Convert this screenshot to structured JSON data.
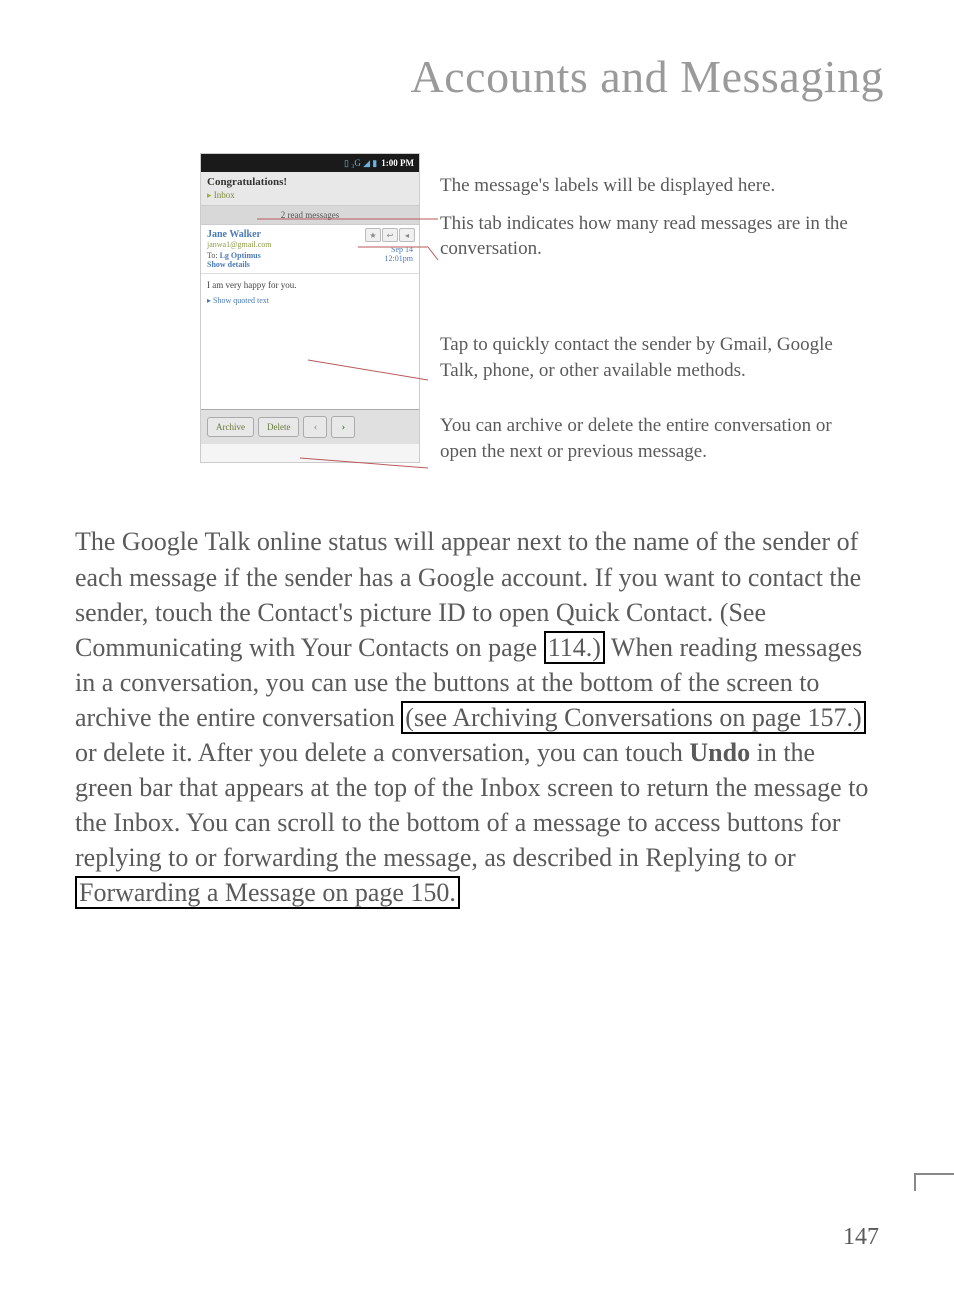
{
  "page_title": "Accounts and Messaging",
  "phone": {
    "status_time": "1:00 PM",
    "congrats": "Congratulations!",
    "inbox": "Inbox",
    "read_messages": "2 read messages",
    "sender_name": "Jane Walker",
    "sender_email": "janwa1@gmail.com",
    "to_prefix": "To:",
    "to_name": "Lg Optimus",
    "show_details": "Show details",
    "date": "Sep 14",
    "time": "12:01pm",
    "body_text": "I am very happy for you.",
    "quoted_text": "▸ Show quoted text",
    "archive_btn": "Archive",
    "delete_btn": "Delete"
  },
  "callouts": {
    "c1": "The message's labels will be displayed here.",
    "c2": "This tab indicates how many read messages are in the conversation.",
    "c3": "Tap to quickly contact the sender by Gmail, Google Talk, phone, or other available methods.",
    "c4": "You can archive or delete the entire conversation or open the next or previous message."
  },
  "main_text": {
    "p1a": "The Google Talk online status will appear next to the name of the sender of each message if the sender has a Google account. If you want to contact the sender, touch the Contact's picture ID to open Quick Contact. (See Communicating with Your Contacts on page ",
    "link1": "114.)",
    "p1b": " When reading messages in a conversation, you can use the buttons at the bottom of the screen to archive the entire conversation ",
    "link2": "(see Archiving Conversations on page 157.)",
    "p1c": " or delete it. After you delete a conversation, you can touch ",
    "undo": "Undo",
    "p1d": " in the green bar that appears at the top of the Inbox screen to return the message to the Inbox. You can scroll to the bottom of a message to access buttons for replying to or forwarding the message, as described in Replying to or ",
    "link3": "Forwarding a Message on page 150.",
    "p1e": ""
  },
  "page_number": "147"
}
